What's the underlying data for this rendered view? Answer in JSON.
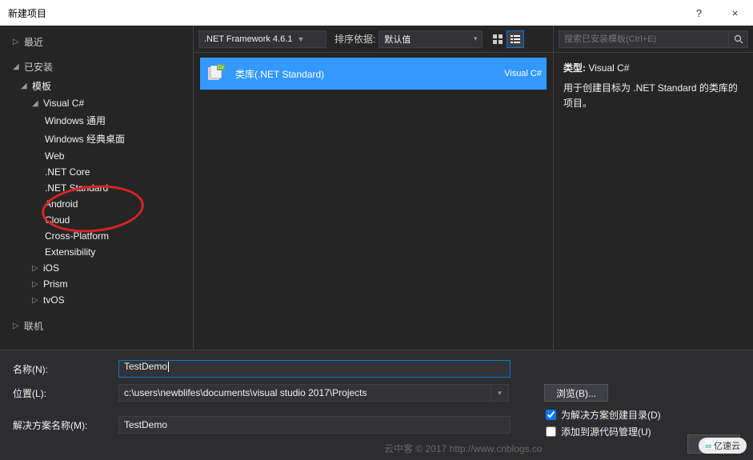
{
  "title": "新建项目",
  "titlebar": {
    "help": "?",
    "close": "×"
  },
  "sidebar": {
    "recent": "最近",
    "installed": "已安装",
    "template": "模板",
    "visual_csharp": "Visual C#",
    "items": [
      "Windows 通用",
      "Windows 经典桌面",
      "Web",
      ".NET Core",
      ".NET Standard",
      "Android",
      "Cloud",
      "Cross-Platform",
      "Extensibility"
    ],
    "collapsed": [
      "iOS",
      "Prism",
      "tvOS"
    ],
    "online": "联机"
  },
  "toolbar": {
    "framework": ".NET Framework 4.6.1",
    "sort_label": "排序依据:",
    "sort_value": "默认值"
  },
  "template": {
    "name": "类库(.NET Standard)",
    "lang": "Visual C#"
  },
  "right": {
    "search_placeholder": "搜索已安装模板(Ctrl+E)",
    "type_label": "类型:",
    "type_value": "Visual C#",
    "desc": "用于创建目标为 .NET Standard 的类库的项目。"
  },
  "form": {
    "name_label": "名称(N):",
    "name_value": "TestDemo",
    "location_label": "位置(L):",
    "location_value": "c:\\users\\newblifes\\documents\\visual studio 2017\\Projects",
    "browse": "浏览(B)...",
    "solution_label": "解决方案名称(M):",
    "solution_value": "TestDemo",
    "check1": "为解决方案创建目录(D)",
    "check2": "添加到源代码管理(U)"
  },
  "buttons": {
    "ok": "确定"
  },
  "watermark": "云中客 © 2017 http://www.cnblogs.co",
  "watermark2": "亿速云"
}
